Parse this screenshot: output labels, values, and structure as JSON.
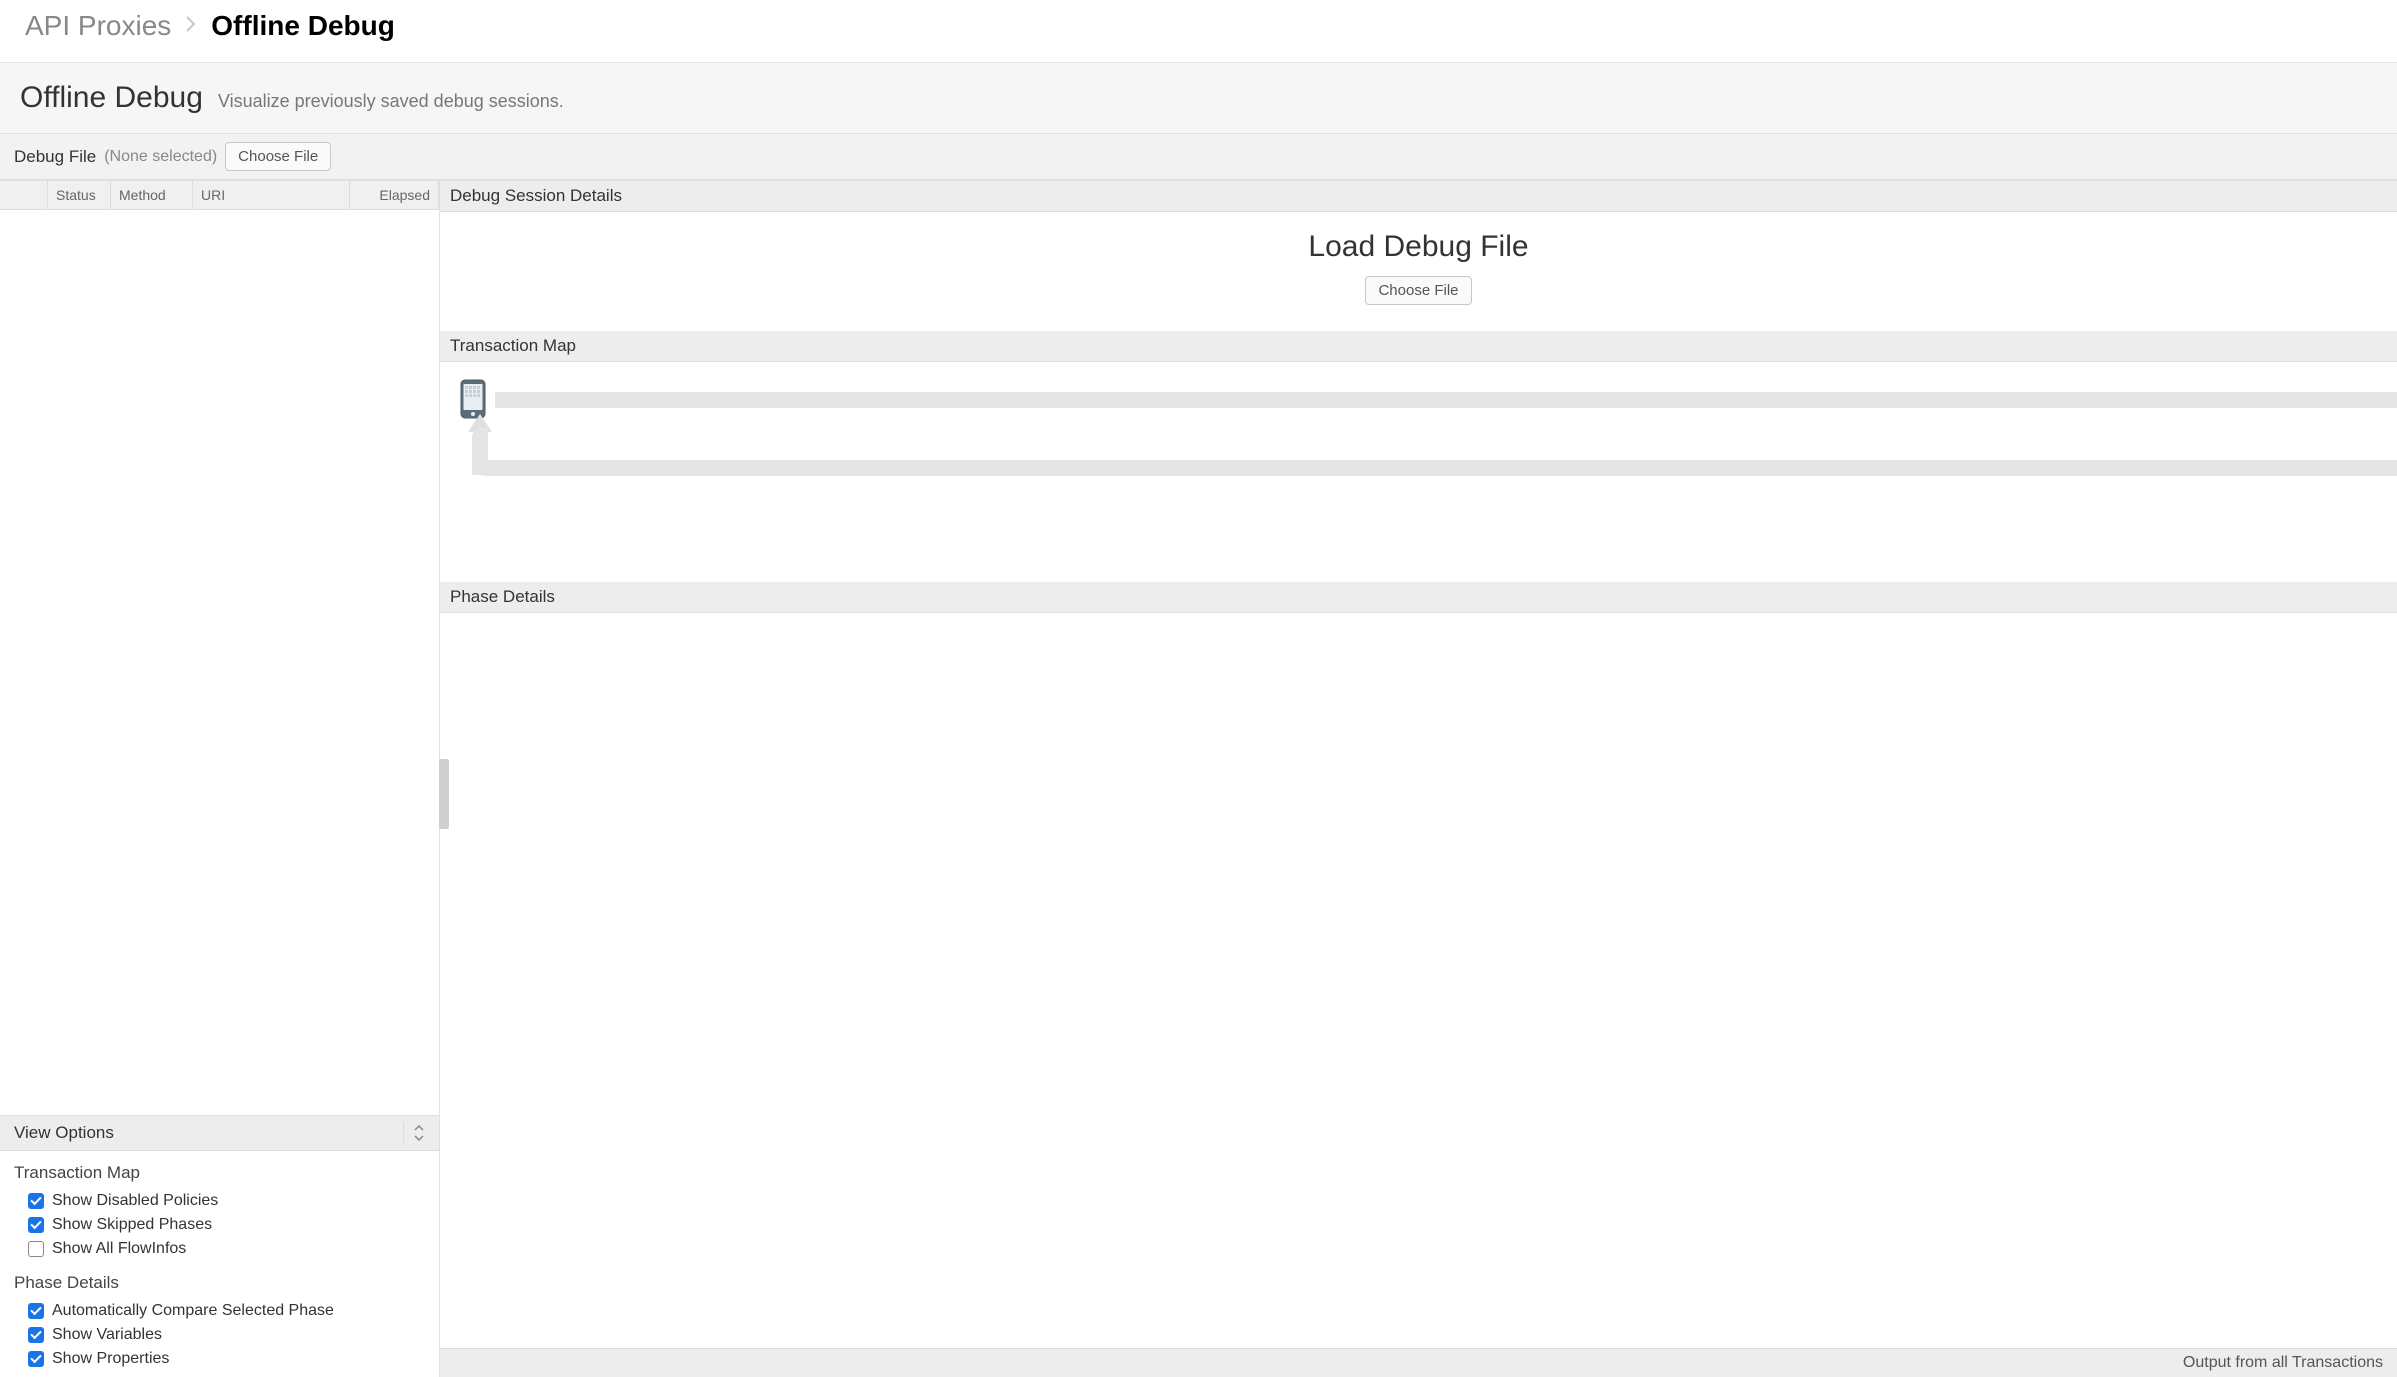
{
  "breadcrumb": {
    "parent": "API Proxies",
    "current": "Offline Debug"
  },
  "header": {
    "title": "Offline Debug",
    "subtitle": "Visualize previously saved debug sessions."
  },
  "debug_file": {
    "label": "Debug File",
    "none_selected": "(None selected)",
    "choose_button": "Choose File"
  },
  "table": {
    "columns": [
      "Status",
      "Method",
      "URI",
      "Elapsed"
    ]
  },
  "view_options": {
    "title": "View Options",
    "transaction_map_title": "Transaction Map",
    "phase_details_title": "Phase Details",
    "checkboxes": {
      "show_disabled_policies": {
        "label": "Show Disabled Policies",
        "checked": true
      },
      "show_skipped_phases": {
        "label": "Show Skipped Phases",
        "checked": true
      },
      "show_all_flowinfos": {
        "label": "Show All FlowInfos",
        "checked": false
      },
      "auto_compare": {
        "label": "Automatically Compare Selected Phase",
        "checked": true
      },
      "show_variables": {
        "label": "Show Variables",
        "checked": true
      },
      "show_properties": {
        "label": "Show Properties",
        "checked": true
      }
    }
  },
  "details": {
    "session_title": "Debug Session Details",
    "load_title": "Load Debug File",
    "choose_button": "Choose File",
    "transaction_map_title": "Transaction Map",
    "phase_details_title": "Phase Details"
  },
  "footer": {
    "output_label": "Output from all Transactions"
  }
}
